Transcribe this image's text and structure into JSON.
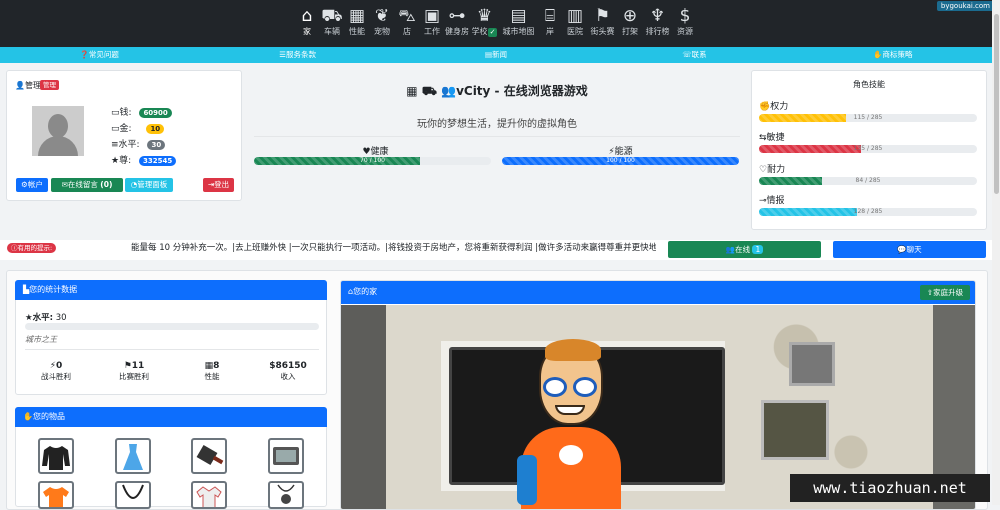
{
  "topnav": {
    "items": [
      {
        "label": "家",
        "icon": "home-icon"
      },
      {
        "label": "车辆",
        "icon": "car-icon"
      },
      {
        "label": "性能",
        "icon": "building-icon"
      },
      {
        "label": "宠物",
        "icon": "paw-icon"
      },
      {
        "label": "店",
        "icon": "cart-icon"
      },
      {
        "label": "工作",
        "icon": "briefcase-icon"
      },
      {
        "label": "健身房",
        "icon": "dumbbell-icon"
      },
      {
        "label": "学校",
        "icon": "graduation-cap-icon"
      },
      {
        "label": "城市地图",
        "icon": "map-icon"
      },
      {
        "label": "岸",
        "icon": "bank-icon"
      },
      {
        "label": "医院",
        "icon": "hospital-icon"
      },
      {
        "label": "街头赛",
        "icon": "flag-icon"
      },
      {
        "label": "打架",
        "icon": "crosshair-icon"
      },
      {
        "label": "排行榜",
        "icon": "trophy-icon"
      },
      {
        "label": "资源",
        "icon": "dollar-icon"
      }
    ],
    "site_badge": "bygoukai.com"
  },
  "subnav": [
    "常见问题",
    "服务条款",
    "新闻",
    "联系",
    "商标策略"
  ],
  "profile": {
    "role_label": "管理",
    "role_badge": "管理",
    "stats": [
      {
        "label": "钱:",
        "value": "60900",
        "color": "#198754"
      },
      {
        "label": "金:",
        "value": "10",
        "color": "#ffc107"
      },
      {
        "label": "水平:",
        "value": "30",
        "color": "#6c757d"
      },
      {
        "label": "尊:",
        "value": "332545",
        "color": "#0d6efd"
      }
    ],
    "buttons": {
      "account": "帐户",
      "message": "在线留言",
      "message_count": "(0)",
      "admin": "管理面板",
      "logout": "登出"
    }
  },
  "center": {
    "title": "vCity - 在线浏览器游戏",
    "subtitle": "玩你的梦想生活，提升你的虚拟角色",
    "health_label": "健康",
    "health_text": "70 / 100",
    "health_pct": 0.7,
    "energy_label": "能源",
    "energy_text": "100 / 100",
    "energy_pct": 1.0
  },
  "skills": {
    "title": "角色技能",
    "items": [
      {
        "label": "权力",
        "text": "115 / 285",
        "pct": 0.4,
        "color": "#ffc107"
      },
      {
        "label": "敏捷",
        "text": "135 / 285",
        "pct": 0.47,
        "color": "#dc3545"
      },
      {
        "label": "耐力",
        "text": "84 / 285",
        "pct": 0.29,
        "color": "#198754"
      },
      {
        "label": "情报",
        "text": "128 / 285",
        "pct": 0.45,
        "color": "#24c3e6"
      }
    ]
  },
  "ticker": {
    "tip_label": "有用的提示:",
    "text": "能量每 10 分钟补充一次。|去上班赚外快 |一次只能执行一项活动。|将钱投资于房地产，您将重新获得利润 |做许多活动来赢得尊重并更快地提",
    "online_label": "在线",
    "online_count": "1",
    "chat_label": "聊天"
  },
  "statistics": {
    "header": "您的统计数据",
    "level_label": "水平:",
    "level_value": "30",
    "level_pct": 0.0,
    "rank_title": "城市之王",
    "counters": [
      {
        "value": "0",
        "label": "战斗胜利"
      },
      {
        "value": "11",
        "label": "比赛胜利"
      },
      {
        "value": "8",
        "label": "性能"
      },
      {
        "value": "$86150",
        "label": "收入"
      }
    ]
  },
  "items_panel": {
    "header": "您的物品"
  },
  "home_panel": {
    "header": "您的家",
    "upgrade_label": "家庭升级"
  },
  "watermark": "www.tiaozhuan.net",
  "colors": {
    "primary": "#0d6efd",
    "info": "#24c3e6",
    "success": "#198754",
    "danger": "#dc3545",
    "dark": "#212529"
  }
}
